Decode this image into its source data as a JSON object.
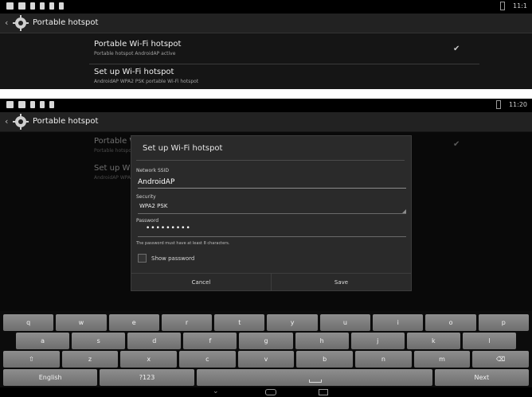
{
  "status_bar": {
    "time_top": "11:1",
    "time_bottom": "11:20"
  },
  "action_bar": {
    "title": "Portable hotspot"
  },
  "settings": {
    "hotspot_toggle": {
      "title": "Portable Wi-Fi hotspot",
      "summary": "Portable hotspot AndroidAP active"
    },
    "setup": {
      "title": "Set up Wi-Fi hotspot",
      "summary": "AndroidAP WPA2 PSK portable Wi-Fi hotspot"
    }
  },
  "dialog": {
    "title": "Set up Wi-Fi hotspot",
    "ssid_label": "Network SSID",
    "ssid_value": "AndroidAP",
    "security_label": "Security",
    "security_value": "WPA2 PSK",
    "password_label": "Password",
    "password_mask": "•••••••••",
    "password_hint": "The password must have at least 8 characters.",
    "show_password": "Show password",
    "cancel": "Cancel",
    "save": "Save"
  },
  "keyboard": {
    "row1": [
      "q",
      "w",
      "e",
      "r",
      "t",
      "y",
      "u",
      "i",
      "o",
      "p"
    ],
    "row2": [
      "a",
      "s",
      "d",
      "f",
      "g",
      "h",
      "j",
      "k",
      "l"
    ],
    "row3": [
      "⇧",
      "z",
      "x",
      "c",
      "v",
      "b",
      "n",
      "m",
      "⌫"
    ],
    "row4": {
      "lang": "English",
      "symbols": "?123",
      "next": "Next"
    }
  }
}
